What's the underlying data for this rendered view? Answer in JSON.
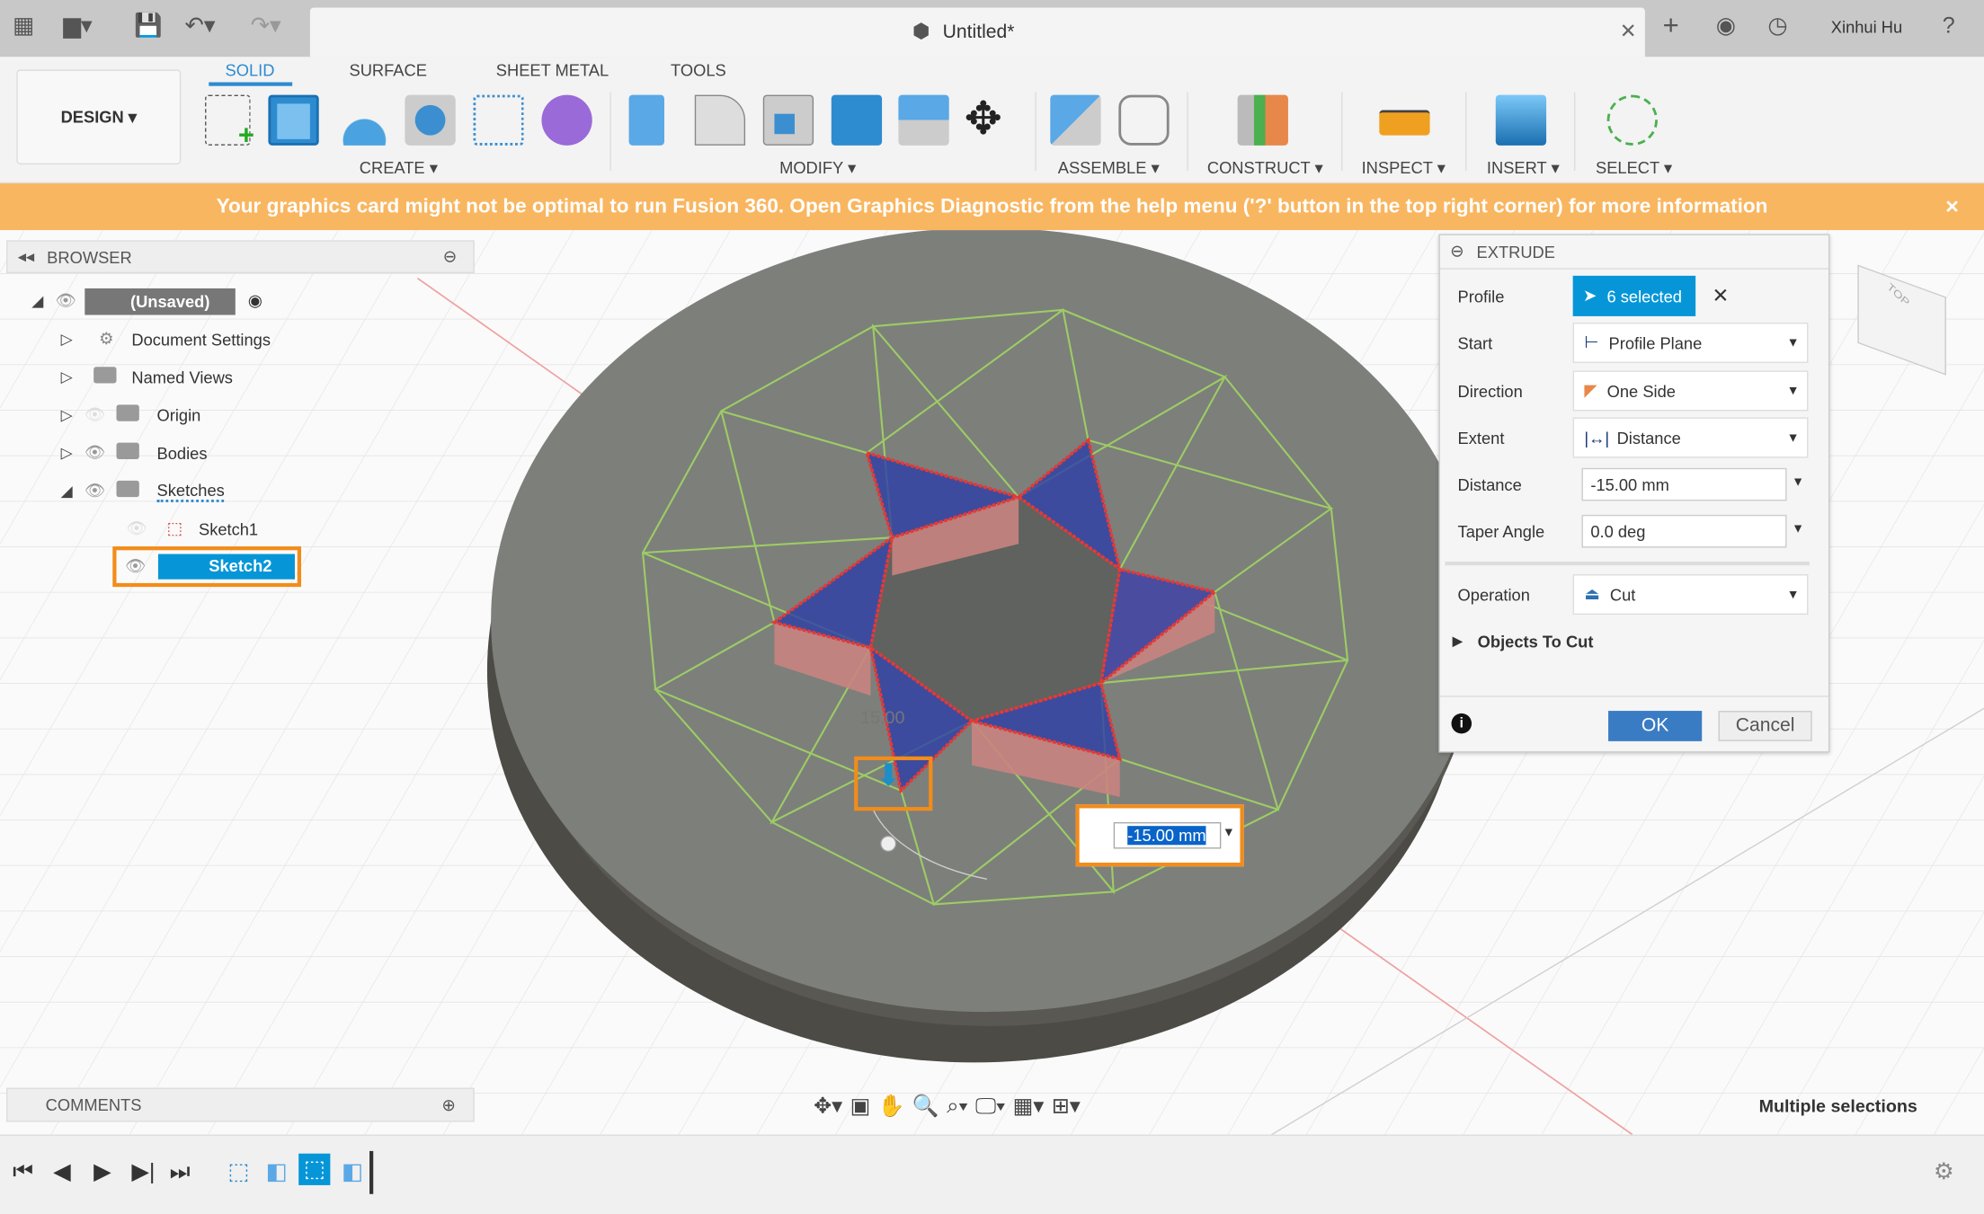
{
  "titlebar": {
    "doc_title": "Untitled*",
    "user": "Xinhui Hu",
    "icons": [
      "grid-icon",
      "file-icon",
      "save-icon",
      "undo-icon",
      "redo-icon",
      "close-tab-icon",
      "new-tab-icon",
      "extensions-icon",
      "clock-icon",
      "help-icon"
    ]
  },
  "ribbon": {
    "workspace": "DESIGN",
    "tabs": [
      {
        "label": "SOLID",
        "active": true
      },
      {
        "label": "SURFACE"
      },
      {
        "label": "SHEET METAL"
      },
      {
        "label": "TOOLS"
      }
    ],
    "groups": [
      "CREATE",
      "MODIFY",
      "ASSEMBLE",
      "CONSTRUCT",
      "INSPECT",
      "INSERT",
      "SELECT"
    ]
  },
  "banner": {
    "text": "Your graphics card might not be optimal to run Fusion 360. Open Graphics Diagnostic from the help menu ('?' button in the top right corner) for more information",
    "close": "×"
  },
  "browser": {
    "title": "BROWSER",
    "items": [
      {
        "label": "(Unsaved)"
      },
      {
        "label": "Document Settings"
      },
      {
        "label": "Named Views"
      },
      {
        "label": "Origin"
      },
      {
        "label": "Bodies"
      },
      {
        "label": "Sketches"
      },
      {
        "label": "Sketch1"
      },
      {
        "label": "Sketch2",
        "selected": true
      }
    ]
  },
  "extrude": {
    "title": "EXTRUDE",
    "profile": {
      "label": "Profile",
      "value": "6 selected"
    },
    "start": {
      "label": "Start",
      "value": "Profile Plane"
    },
    "direction": {
      "label": "Direction",
      "value": "One Side"
    },
    "extent": {
      "label": "Extent",
      "value": "Distance"
    },
    "distance": {
      "label": "Distance",
      "value": "-15.00 mm"
    },
    "taper": {
      "label": "Taper Angle",
      "value": "0.0 deg"
    },
    "operation": {
      "label": "Operation",
      "value": "Cut"
    },
    "objects_to_cut": "Objects To Cut",
    "ok": "OK",
    "cancel": "Cancel"
  },
  "viewport": {
    "distance_input": "-15.00 mm",
    "dim_label": "15.00",
    "status": "Multiple selections",
    "viewcube_label": "TOP"
  },
  "comments": {
    "title": "COMMENTS"
  },
  "timeline": {
    "controls": [
      "first",
      "previous",
      "play",
      "next",
      "last"
    ],
    "steps": [
      "sketch",
      "extrude",
      "sketch",
      "extrude"
    ],
    "current_step": 3
  },
  "colors": {
    "accent": "#0696d7",
    "banner": "#f9b660",
    "highlight_orange": "#f28c1a",
    "profile_blue": "#2c3e9e",
    "profile_red": "#e03030",
    "sketch_green": "#8bc34a"
  }
}
